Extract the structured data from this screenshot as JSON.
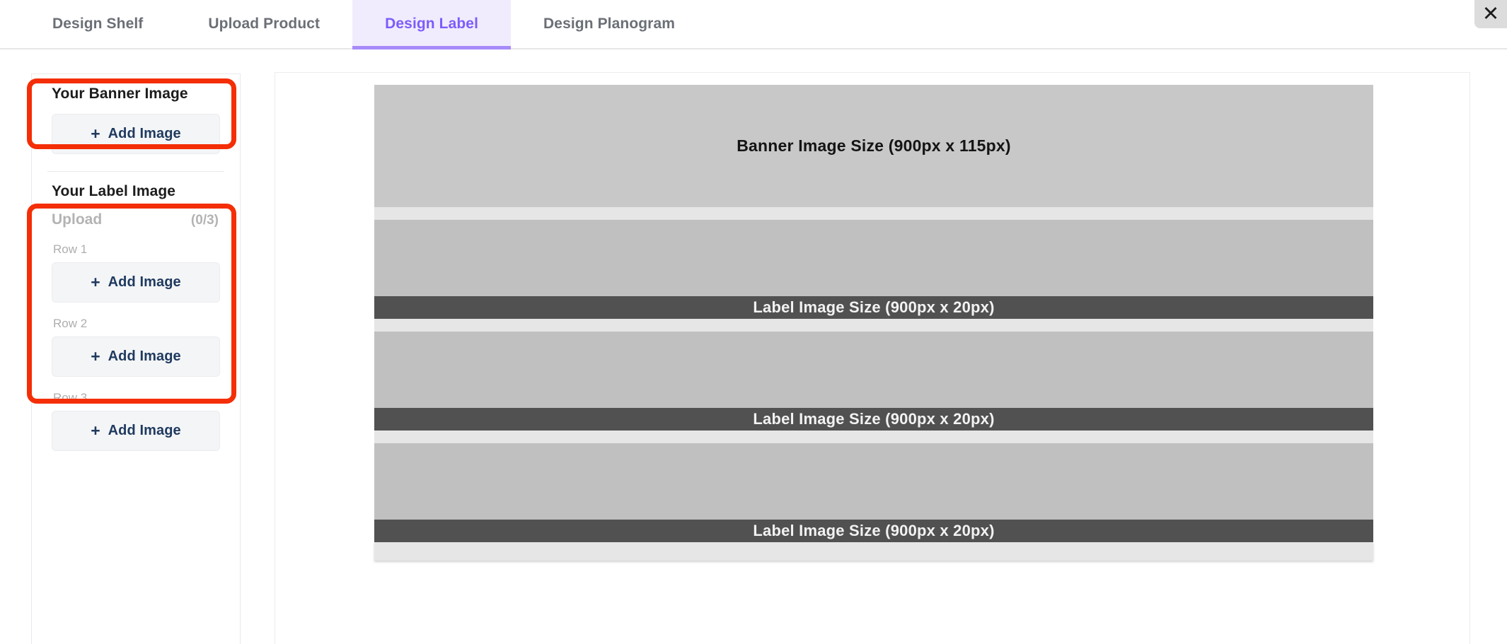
{
  "tabs": [
    {
      "label": "Design Shelf",
      "active": false
    },
    {
      "label": "Upload Product",
      "active": false
    },
    {
      "label": "Design Label",
      "active": true
    },
    {
      "label": "Design Planogram",
      "active": false
    }
  ],
  "window": {
    "close_icon": "close-icon",
    "close_glyph": "✕"
  },
  "sidebar": {
    "banner_panel": {
      "title": "Your Banner Image",
      "add_button_label": "Add Image",
      "plus_glyph": "+"
    },
    "label_panel": {
      "title": "Your Label Image",
      "upload_label": "Upload",
      "upload_count": "(0/3)",
      "rows": [
        {
          "row_label": "Row 1",
          "add_button_label": "Add Image",
          "plus_glyph": "+"
        },
        {
          "row_label": "Row 2",
          "add_button_label": "Add Image",
          "plus_glyph": "+"
        },
        {
          "row_label": "Row 3",
          "add_button_label": "Add Image",
          "plus_glyph": "+"
        }
      ]
    }
  },
  "canvas": {
    "banner": {
      "text": "Banner Image Size (900px x 115px)"
    },
    "shelves": [
      {
        "label_text": "Label Image Size (900px x 20px)"
      },
      {
        "label_text": "Label Image Size (900px x 20px)"
      },
      {
        "label_text": "Label Image Size (900px x 20px)"
      }
    ]
  },
  "annotations": {
    "highlight_color": "#f42e06",
    "banner_region": "Your Banner Image",
    "label_region": "Your Label Image"
  },
  "colors": {
    "accent_purple": "#7c5cfc",
    "active_tab_bg": "#f1ecfd",
    "active_tab_underline": "#a78bfa",
    "button_text": "#1f3a5f",
    "button_bg": "#f4f5f7",
    "muted_text": "#b3b3b3",
    "banner_placeholder": "#c8c8c8",
    "shelf_placeholder": "#c0c0c0",
    "label_bar": "#515151",
    "gap_strip": "#e6e6e6"
  }
}
